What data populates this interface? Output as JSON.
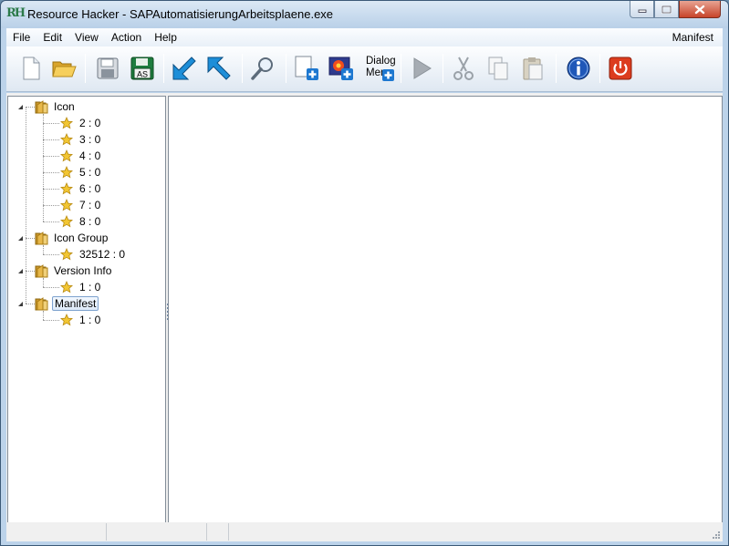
{
  "window": {
    "title": "Resource Hacker - SAPAutomatisierungArbeitsplaene.exe",
    "logo_text": "RH",
    "controls": [
      "minimize-icon",
      "maximize-icon",
      "close-icon"
    ]
  },
  "menubar": {
    "items": [
      "File",
      "Edit",
      "View",
      "Action",
      "Help"
    ],
    "right_label": "Manifest"
  },
  "toolbar": {
    "buttons": [
      {
        "name": "new-file",
        "icon": "new-file-icon"
      },
      {
        "name": "open-file",
        "icon": "folder-open-icon"
      },
      {
        "name": "save",
        "icon": "floppy-disk-icon"
      },
      {
        "name": "save-as",
        "icon": "floppy-disk-as-icon",
        "badge": "AS"
      },
      {
        "name": "import",
        "icon": "arrow-down-left-icon"
      },
      {
        "name": "export",
        "icon": "arrow-up-left-icon"
      },
      {
        "name": "find",
        "icon": "magnifier-icon"
      },
      {
        "name": "add-blank-resource",
        "icon": "add-resource-icon"
      },
      {
        "name": "add-image-resource",
        "icon": "add-image-icon"
      },
      {
        "name": "dialog-menu",
        "icon": "dialog-menu-icon"
      },
      {
        "name": "compile",
        "icon": "play-icon"
      },
      {
        "name": "cut",
        "icon": "scissors-icon"
      },
      {
        "name": "copy",
        "icon": "copy-icon"
      },
      {
        "name": "paste",
        "icon": "paste-icon"
      },
      {
        "name": "about",
        "icon": "info-icon"
      },
      {
        "name": "exit",
        "icon": "power-icon"
      }
    ],
    "dialog_button_line1": "Dialog",
    "dialog_button_line2": "Menu"
  },
  "tree": {
    "groups": [
      {
        "label": "Icon",
        "expanded": true,
        "selected": false,
        "items": [
          "2 : 0",
          "3 : 0",
          "4 : 0",
          "5 : 0",
          "6 : 0",
          "7 : 0",
          "8 : 0"
        ]
      },
      {
        "label": "Icon Group",
        "expanded": true,
        "selected": false,
        "items": [
          "32512 : 0"
        ]
      },
      {
        "label": "Version Info",
        "expanded": true,
        "selected": false,
        "items": [
          "1 : 0"
        ]
      },
      {
        "label": "Manifest",
        "expanded": true,
        "selected": true,
        "items": [
          "1 : 0"
        ]
      }
    ]
  },
  "colors": {
    "folder": "#e8b84a",
    "star": "#f2c633",
    "selection_border": "#7da2ce",
    "info_blue": "#1f57b8",
    "power_red": "#dc3c1e",
    "arrow_blue": "#1d8ed8"
  }
}
